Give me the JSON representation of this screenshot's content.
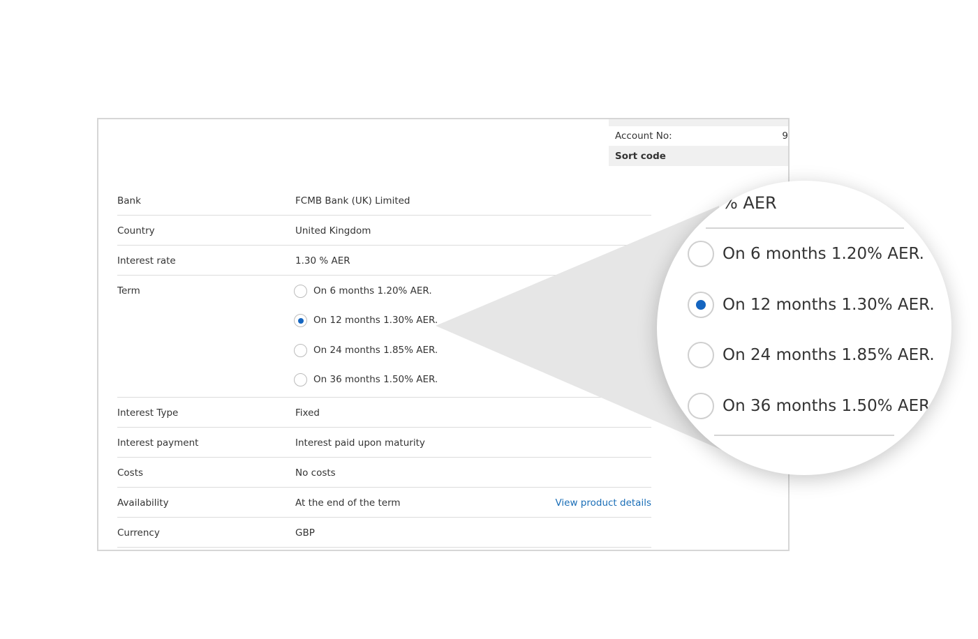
{
  "account": {
    "account_no_label": "Account No:",
    "account_no_value_fragment": "9",
    "sort_code_label": "Sort code"
  },
  "details": {
    "bank": {
      "label": "Bank",
      "value": "FCMB Bank (UK) Limited"
    },
    "country": {
      "label": "Country",
      "value": "United Kingdom"
    },
    "interest_rate": {
      "label": "Interest rate",
      "value": "1.30 % AER"
    },
    "term": {
      "label": "Term",
      "options": [
        {
          "label": "On 6 months 1.20% AER.",
          "selected": false
        },
        {
          "label": "On 12 months 1.30% AER.",
          "selected": true
        },
        {
          "label": "On 24 months 1.85% AER.",
          "selected": false
        },
        {
          "label": "On 36 months 1.50% AER.",
          "selected": false
        }
      ]
    },
    "interest_type": {
      "label": "Interest Type",
      "value": "Fixed"
    },
    "interest_payment": {
      "label": "Interest payment",
      "value": "Interest paid upon maturity"
    },
    "costs": {
      "label": "Costs",
      "value": "No costs"
    },
    "availability": {
      "label": "Availability",
      "value": "At the end of the term",
      "link": "View product details"
    },
    "currency": {
      "label": "Currency",
      "value": "GBP"
    }
  },
  "zoom": {
    "top_fragment": "% AER"
  },
  "colors": {
    "accent": "#1565c0",
    "link": "#1a6eb7",
    "border": "#d6d6d6",
    "divider": "#dcdcdc"
  }
}
